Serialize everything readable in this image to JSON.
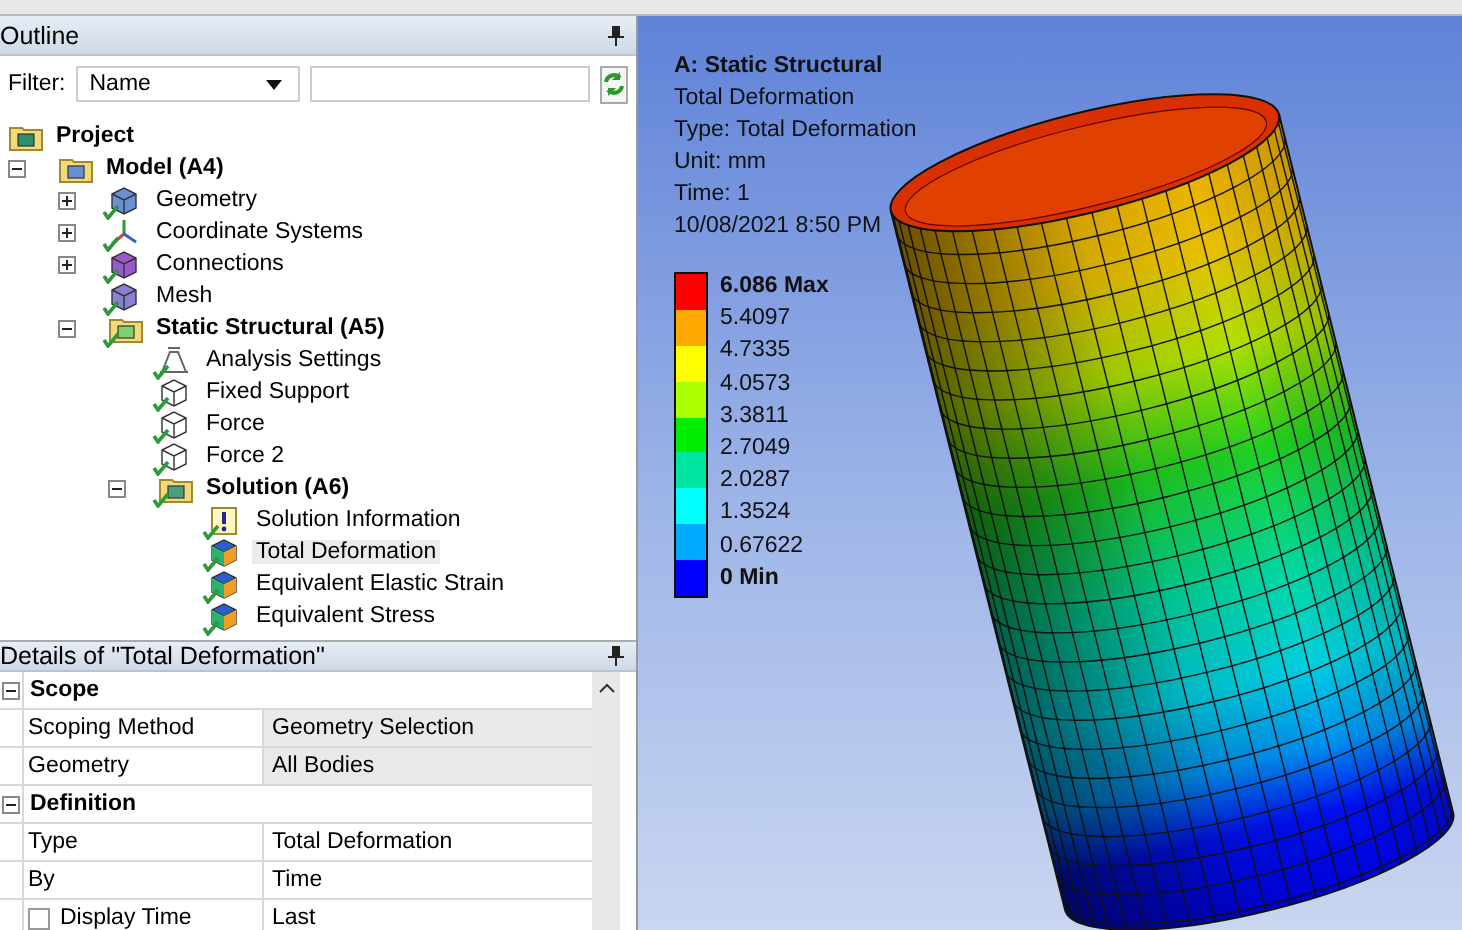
{
  "outline": {
    "title": "Outline",
    "filter": {
      "label": "Filter:",
      "value": "Name"
    },
    "tree": [
      {
        "label": "Project",
        "kind": "project",
        "bold": true,
        "checked": false,
        "selected": false,
        "children": [
          {
            "label": "Model (A4)",
            "kind": "model",
            "bold": true,
            "checked": false,
            "selected": false,
            "expanded": true,
            "children": [
              {
                "label": "Geometry",
                "kind": "geometry",
                "bold": false,
                "checked": true,
                "selected": false,
                "expanded": false
              },
              {
                "label": "Coordinate Systems",
                "kind": "axes",
                "bold": false,
                "checked": true,
                "selected": false,
                "expanded": false
              },
              {
                "label": "Connections",
                "kind": "connections",
                "bold": false,
                "checked": true,
                "selected": false,
                "expanded": false
              },
              {
                "label": "Mesh",
                "kind": "mesh",
                "bold": false,
                "checked": true,
                "selected": false
              },
              {
                "label": "Static Structural (A5)",
                "kind": "environment",
                "bold": true,
                "checked": true,
                "selected": false,
                "expanded": true,
                "children": [
                  {
                    "label": "Analysis Settings",
                    "kind": "settings",
                    "bold": false,
                    "checked": true,
                    "selected": false
                  },
                  {
                    "label": "Fixed Support",
                    "kind": "support",
                    "bold": false,
                    "checked": true,
                    "selected": false
                  },
                  {
                    "label": "Force",
                    "kind": "force",
                    "bold": false,
                    "checked": true,
                    "selected": false
                  },
                  {
                    "label": "Force 2",
                    "kind": "force",
                    "bold": false,
                    "checked": true,
                    "selected": false
                  },
                  {
                    "label": "Solution (A6)",
                    "kind": "solution",
                    "bold": true,
                    "checked": true,
                    "selected": false,
                    "expanded": true,
                    "children": [
                      {
                        "label": "Solution Information",
                        "kind": "info",
                        "bold": false,
                        "checked": true,
                        "selected": false
                      },
                      {
                        "label": "Total Deformation",
                        "kind": "result",
                        "bold": false,
                        "checked": true,
                        "selected": true
                      },
                      {
                        "label": "Equivalent Elastic Strain",
                        "kind": "result",
                        "bold": false,
                        "checked": true,
                        "selected": false
                      },
                      {
                        "label": "Equivalent Stress",
                        "kind": "result",
                        "bold": false,
                        "checked": true,
                        "selected": false
                      }
                    ]
                  }
                ]
              }
            ]
          }
        ]
      }
    ]
  },
  "details": {
    "title": "Details of \"Total Deformation\"",
    "sections": [
      {
        "title": "Scope",
        "expanded": true,
        "rows": [
          {
            "kind": "plain",
            "label": "Scoping Method",
            "value": "Geometry Selection",
            "highlighted": true
          },
          {
            "kind": "plain",
            "label": "Geometry",
            "value": "All Bodies",
            "highlighted": true
          }
        ]
      },
      {
        "title": "Definition",
        "expanded": true,
        "rows": [
          {
            "kind": "plain",
            "label": "Type",
            "value": "Total Deformation",
            "highlighted": false
          },
          {
            "kind": "plain",
            "label": "By",
            "value": "Time",
            "highlighted": false
          },
          {
            "kind": "checkbox",
            "label": "Display Time",
            "value": "Last",
            "highlighted": false,
            "checked": false
          }
        ]
      }
    ]
  },
  "viewport": {
    "annotation": {
      "title": "A: Static Structural",
      "lines": [
        "Total Deformation",
        "Type: Total Deformation",
        "Unit: mm",
        "Time: 1",
        "10/08/2021 8:50 PM"
      ]
    },
    "legend": {
      "labels": [
        {
          "text": "6.086 Max",
          "bold": true
        },
        {
          "text": "5.4097",
          "bold": false
        },
        {
          "text": "4.7335",
          "bold": false
        },
        {
          "text": "4.0573",
          "bold": false
        },
        {
          "text": "3.3811",
          "bold": false
        },
        {
          "text": "2.7049",
          "bold": false
        },
        {
          "text": "2.0287",
          "bold": false
        },
        {
          "text": "1.3524",
          "bold": false
        },
        {
          "text": "0.67622",
          "bold": false
        },
        {
          "text": "0 Min",
          "bold": true
        }
      ],
      "bands": [
        {
          "color": "#ff0000"
        },
        {
          "color": "#ffaa00"
        },
        {
          "color": "#ffff00"
        },
        {
          "color": "#aaff00"
        },
        {
          "color": "#00ee00"
        },
        {
          "color": "#00e6a0"
        },
        {
          "color": "#00ffff"
        },
        {
          "color": "#00aaff"
        },
        {
          "color": "#0000ff"
        }
      ]
    }
  }
}
